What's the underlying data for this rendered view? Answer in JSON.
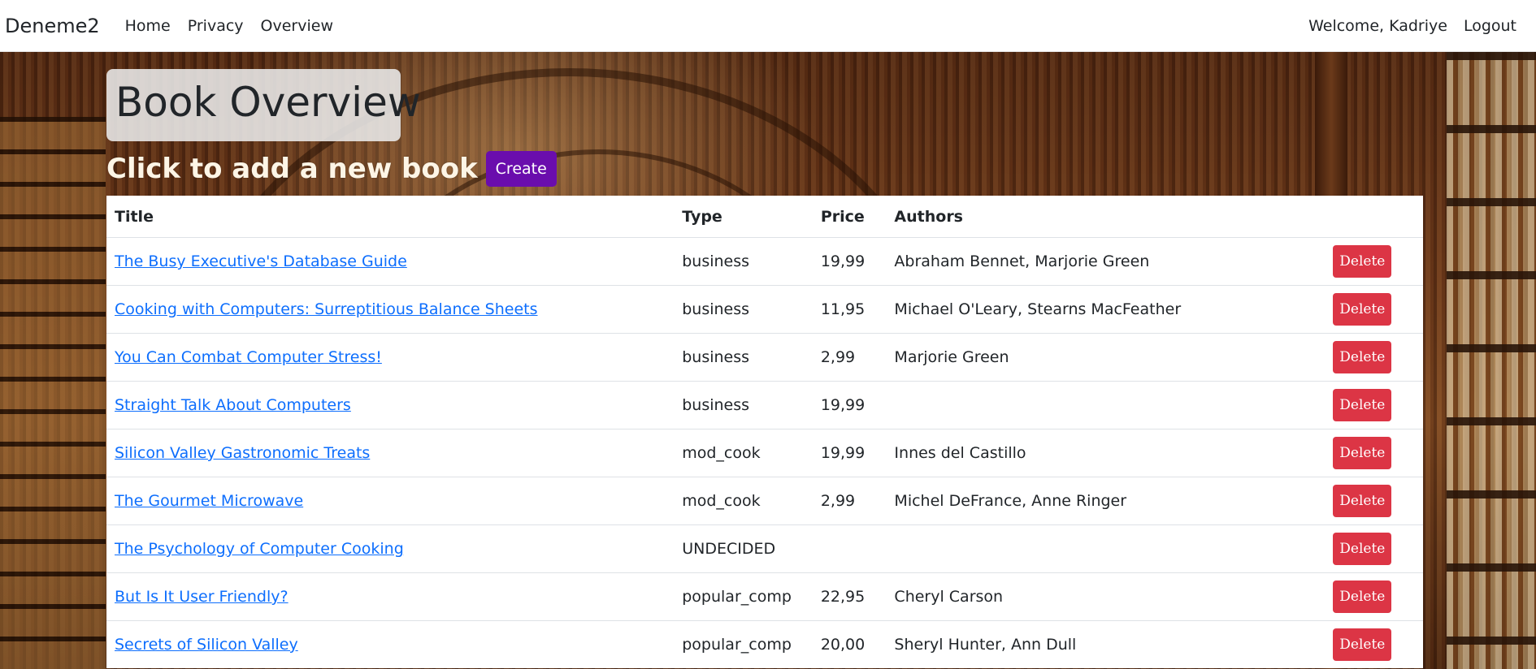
{
  "navbar": {
    "brand": "Deneme2",
    "links": [
      "Home",
      "Privacy",
      "Overview"
    ],
    "welcome": "Welcome, Kadriye",
    "logout": "Logout"
  },
  "page": {
    "title": "Book Overview",
    "add_prompt": "Click to add a new book",
    "create_label": "Create"
  },
  "table": {
    "headers": [
      "Title",
      "Type",
      "Price",
      "Authors"
    ],
    "delete_label": "Delete",
    "rows": [
      {
        "title": "The Busy Executive's Database Guide",
        "type": "business",
        "price": "19,99",
        "authors": "Abraham Bennet, Marjorie Green"
      },
      {
        "title": "Cooking with Computers: Surreptitious Balance Sheets",
        "type": "business",
        "price": "11,95",
        "authors": "Michael O'Leary, Stearns MacFeather"
      },
      {
        "title": "You Can Combat Computer Stress!",
        "type": "business",
        "price": "2,99",
        "authors": "Marjorie Green"
      },
      {
        "title": "Straight Talk About Computers",
        "type": "business",
        "price": "19,99",
        "authors": ""
      },
      {
        "title": "Silicon Valley Gastronomic Treats",
        "type": "mod_cook",
        "price": "19,99",
        "authors": "Innes del Castillo"
      },
      {
        "title": "The Gourmet Microwave",
        "type": "mod_cook",
        "price": "2,99",
        "authors": "Michel DeFrance, Anne Ringer"
      },
      {
        "title": "The Psychology of Computer Cooking",
        "type": "UNDECIDED",
        "price": "",
        "authors": ""
      },
      {
        "title": "But Is It User Friendly?",
        "type": "popular_comp",
        "price": "22,95",
        "authors": "Cheryl Carson"
      },
      {
        "title": "Secrets of Silicon Valley",
        "type": "popular_comp",
        "price": "20,00",
        "authors": "Sheryl Hunter, Ann Dull"
      }
    ]
  },
  "colors": {
    "create_button": "#6a0dad",
    "delete_button": "#dc3545",
    "link": "#0d6efd"
  }
}
